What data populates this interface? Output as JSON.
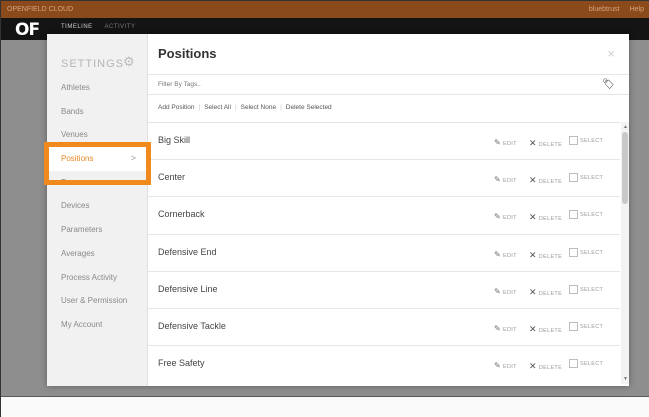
{
  "topbar": {
    "brand": "OPENFIELD CLOUD",
    "user": "bluebtrust",
    "help": "Help"
  },
  "header": {
    "logo": "OF",
    "nav": [
      "TIMELINE",
      "ACTIVITY"
    ]
  },
  "sidebar": {
    "title": "SETTINGS",
    "items": [
      {
        "label": "Athletes"
      },
      {
        "label": "Bands"
      },
      {
        "label": "Venues"
      },
      {
        "label": "Positions"
      },
      {
        "label": "Teams"
      },
      {
        "label": "Devices"
      },
      {
        "label": "Parameters"
      },
      {
        "label": "Averages"
      },
      {
        "label": "Process Activity"
      },
      {
        "label": "User & Permission"
      },
      {
        "label": "My Account"
      }
    ],
    "active_index": 3,
    "active_chevron": ">"
  },
  "content": {
    "title": "Positions",
    "close": "×",
    "filter_placeholder": "Filter By Tags..",
    "actions": {
      "add": "Add Position",
      "select_all": "Select All",
      "select_none": "Select None",
      "delete_selected": "Delete Selected"
    },
    "row_actions": {
      "edit": "EDIT",
      "delete": "DELETE",
      "select": "SELECT"
    },
    "rows": [
      {
        "name": "Big Skill"
      },
      {
        "name": "Center"
      },
      {
        "name": "Cornerback"
      },
      {
        "name": "Defensive End"
      },
      {
        "name": "Defensive Line"
      },
      {
        "name": "Defensive Tackle"
      },
      {
        "name": "Free Safety"
      }
    ]
  },
  "colors": {
    "accent": "#f08a1c",
    "topbar": "#8b4a1c",
    "header": "#141414"
  },
  "icons": {
    "settings": "gear-icon",
    "tag": "tag-icon",
    "edit": "pencil-icon",
    "delete": "x-icon",
    "close": "close-icon"
  }
}
